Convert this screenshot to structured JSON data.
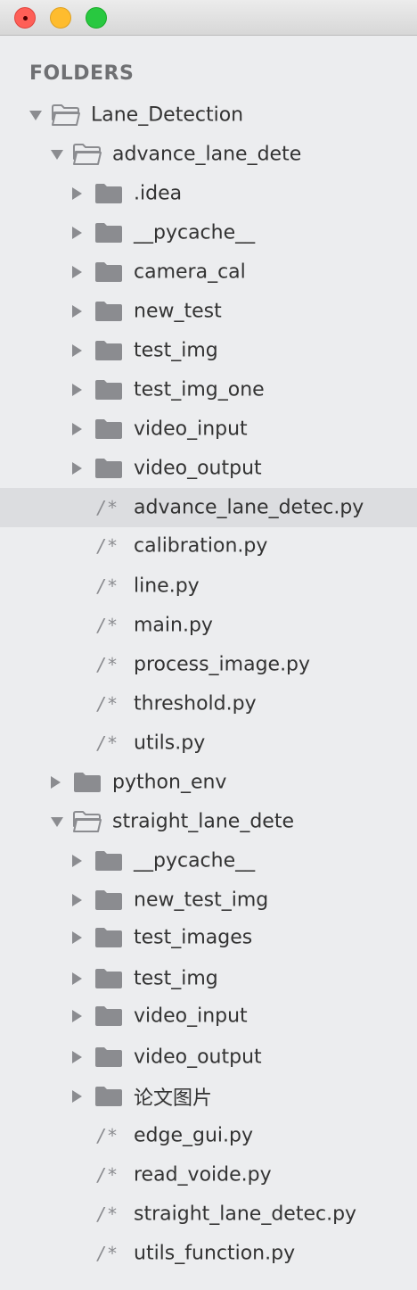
{
  "sidebar": {
    "header": "FOLDERS",
    "items": [
      {
        "label": "Lane_Detection",
        "type": "folder",
        "level": 0,
        "expanded": true
      },
      {
        "label": "advance_lane_dete",
        "type": "folder",
        "level": 1,
        "expanded": true
      },
      {
        "label": ".idea",
        "type": "folder",
        "level": 2,
        "expanded": false
      },
      {
        "label": "__pycache__",
        "type": "folder",
        "level": 2,
        "expanded": false
      },
      {
        "label": "camera_cal",
        "type": "folder",
        "level": 2,
        "expanded": false
      },
      {
        "label": "new_test",
        "type": "folder",
        "level": 2,
        "expanded": false
      },
      {
        "label": "test_img",
        "type": "folder",
        "level": 2,
        "expanded": false
      },
      {
        "label": "test_img_one",
        "type": "folder",
        "level": 2,
        "expanded": false
      },
      {
        "label": "video_input",
        "type": "folder",
        "level": 2,
        "expanded": false
      },
      {
        "label": "video_output",
        "type": "folder",
        "level": 2,
        "expanded": false
      },
      {
        "label": "advance_lane_detec.py",
        "type": "file",
        "level": 2,
        "selected": true
      },
      {
        "label": "calibration.py",
        "type": "file",
        "level": 2
      },
      {
        "label": "line.py",
        "type": "file",
        "level": 2
      },
      {
        "label": "main.py",
        "type": "file",
        "level": 2
      },
      {
        "label": "process_image.py",
        "type": "file",
        "level": 2
      },
      {
        "label": "threshold.py",
        "type": "file",
        "level": 2
      },
      {
        "label": "utils.py",
        "type": "file",
        "level": 2
      },
      {
        "label": "python_env",
        "type": "folder",
        "level": 1,
        "expanded": false
      },
      {
        "label": "straight_lane_dete",
        "type": "folder",
        "level": 1,
        "expanded": true
      },
      {
        "label": "__pycache__",
        "type": "folder",
        "level": 2,
        "expanded": false
      },
      {
        "label": "new_test_img",
        "type": "folder",
        "level": 2,
        "expanded": false
      },
      {
        "label": "test_images",
        "type": "folder",
        "level": 2,
        "expanded": false
      },
      {
        "label": "test_img",
        "type": "folder",
        "level": 2,
        "expanded": false
      },
      {
        "label": "video_input",
        "type": "folder",
        "level": 2,
        "expanded": false
      },
      {
        "label": "video_output",
        "type": "folder",
        "level": 2,
        "expanded": false
      },
      {
        "label": "论文图片",
        "type": "folder",
        "level": 2,
        "expanded": false
      },
      {
        "label": "edge_gui.py",
        "type": "file",
        "level": 2
      },
      {
        "label": "read_voide.py",
        "type": "file",
        "level": 2
      },
      {
        "label": "straight_lane_detec.py",
        "type": "file",
        "level": 2
      },
      {
        "label": "utils_function.py",
        "type": "file",
        "level": 2
      }
    ]
  },
  "icons": {
    "file_glyph": "/*",
    "folder_closed": "folder-icon",
    "folder_open": "folder-open-icon"
  },
  "colors": {
    "sidebar_bg": "#ecedef",
    "selected_bg": "#dcdde0",
    "icon_gray": "#8b8c90",
    "text": "#333333",
    "header_text": "#6f7073"
  }
}
